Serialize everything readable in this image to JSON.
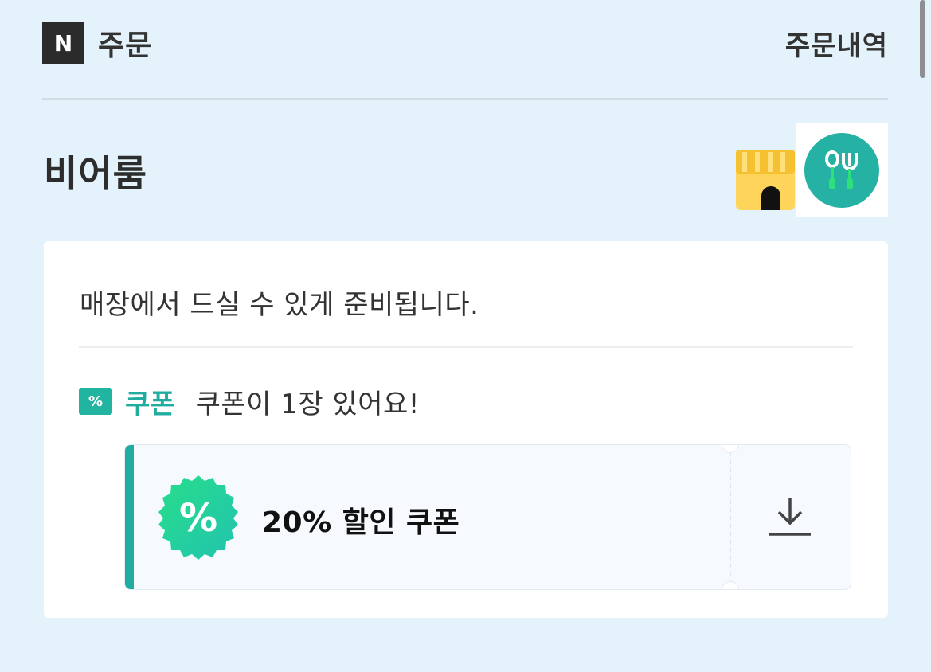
{
  "header": {
    "logo_letter": "N",
    "title": "주문",
    "order_history": "주문내역"
  },
  "store": {
    "name": "비어룸",
    "icons": [
      "shop-icon",
      "dine-in-icon"
    ]
  },
  "card": {
    "notice": "매장에서 드실 수 있게 준비됩니다.",
    "coupon": {
      "tag_symbol": "%",
      "label": "쿠폰",
      "count_text": "쿠폰이 1장 있어요!"
    },
    "ticket": {
      "badge_symbol": "%",
      "title": "20% 할인 쿠폰",
      "action_icon": "download-icon"
    }
  },
  "colors": {
    "background": "#e4f3fb",
    "accent": "#21aca0",
    "card": "#ffffff"
  }
}
